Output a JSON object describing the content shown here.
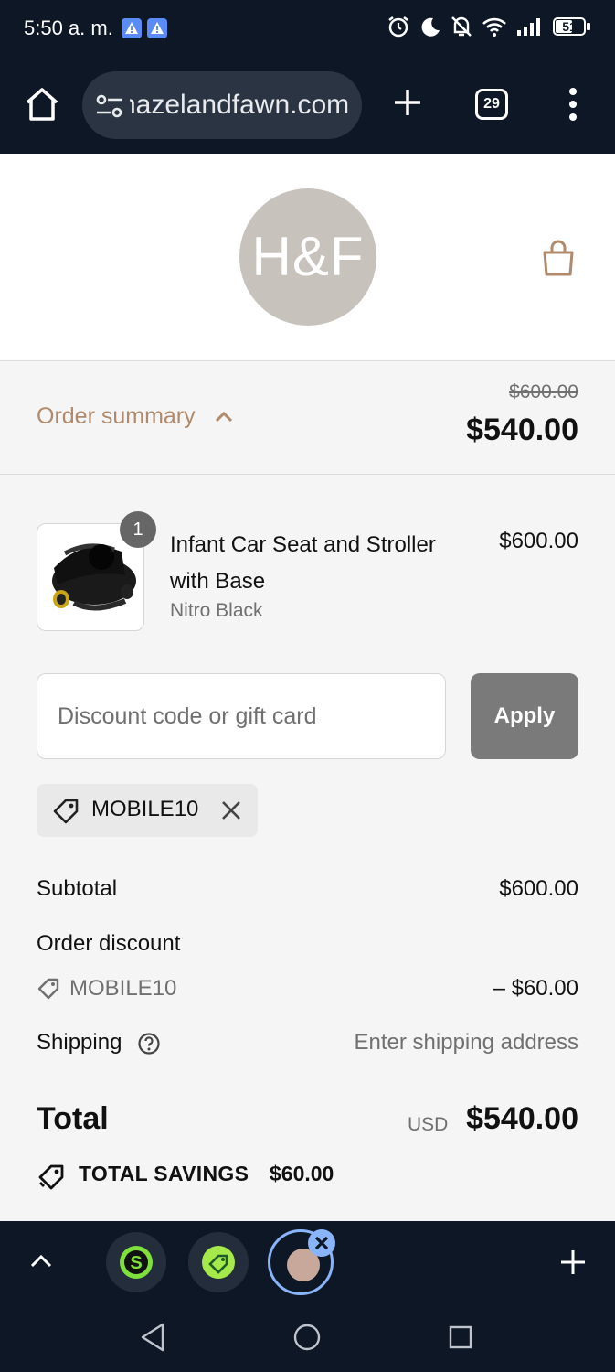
{
  "status_bar": {
    "time": "5:50 a. m.",
    "battery": "51"
  },
  "browser": {
    "url": "hazelandfawn.com",
    "tab_count": "29",
    "icons": [
      "home-icon",
      "site-settings-icon",
      "plus-icon",
      "tab-switcher-icon",
      "more-menu-icon"
    ]
  },
  "store": {
    "logo_text": "H&F",
    "colors": {
      "logo_bg": "#c8c2bd",
      "accent": "#b08a6b"
    }
  },
  "order_summary": {
    "label": "Order summary",
    "original_total": "$600.00",
    "total": "$540.00"
  },
  "line_items": [
    {
      "quantity": "1",
      "name": "Infant Car Seat and Stroller with Base",
      "variant": "Nitro Black",
      "price": "$600.00"
    }
  ],
  "discount": {
    "placeholder": "Discount code or gift card",
    "apply_label": "Apply",
    "applied_code": "MOBILE10"
  },
  "totals": {
    "subtotal_label": "Subtotal",
    "subtotal_value": "$600.00",
    "order_discount_label": "Order discount",
    "discount_code": "MOBILE10",
    "discount_value": "– $60.00",
    "shipping_label": "Shipping",
    "shipping_value": "Enter shipping address",
    "total_label": "Total",
    "currency": "USD",
    "total_value": "$540.00",
    "savings_label": "TOTAL SAVINGS",
    "savings_value": "$60.00"
  },
  "tab_strip": {
    "icons": [
      "chevron-up-icon",
      "tab-favicon-s",
      "tab-favicon-tag",
      "tab-favicon-hf",
      "close-icon",
      "plus-icon"
    ]
  }
}
